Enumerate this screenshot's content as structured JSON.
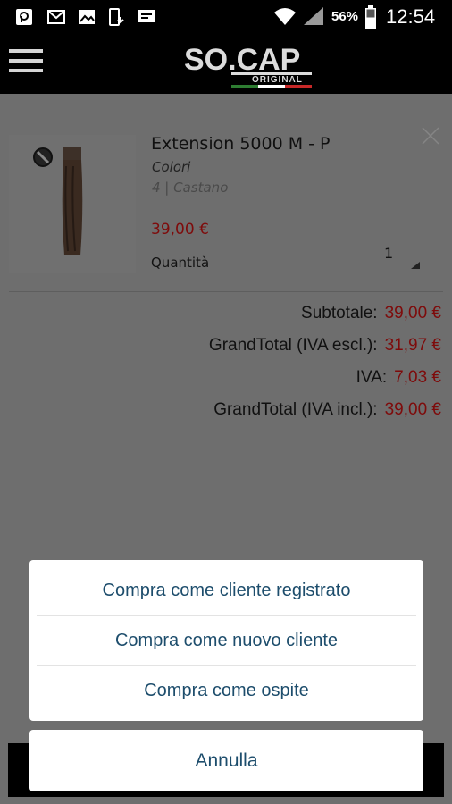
{
  "status_bar": {
    "battery_percent": "56%",
    "time": "12:54",
    "icons": [
      "p-app-icon",
      "mail-icon",
      "image-icon",
      "phone-download-icon",
      "chat-icon",
      "wifi-icon",
      "signal-icon",
      "battery-icon"
    ]
  },
  "header": {
    "logo_main": "SO.CAP",
    "logo_sub": "ORIGINAL",
    "menu_icon": "hamburger-menu-icon"
  },
  "cart_item": {
    "name": "Extension 5000 M - P",
    "attribute_label": "Colori",
    "attribute_value": "4 | Castano",
    "price": "39,00 €",
    "quantity_label": "Quantità",
    "quantity": "1",
    "remove_icon": "close-icon"
  },
  "totals": [
    {
      "label": "Subtotale:",
      "value": "39,00 €"
    },
    {
      "label": "GrandTotal (IVA escl.):",
      "value": "31,97 €"
    },
    {
      "label": "IVA:",
      "value": "7,03 €"
    },
    {
      "label": "GrandTotal (IVA incl.):",
      "value": "39,00 €"
    }
  ],
  "action_sheet": {
    "options": [
      "Compra come cliente registrato",
      "Compra come nuovo cliente",
      "Compra come ospite"
    ],
    "cancel": "Annulla",
    "accent_color": "#1d4d6c"
  }
}
